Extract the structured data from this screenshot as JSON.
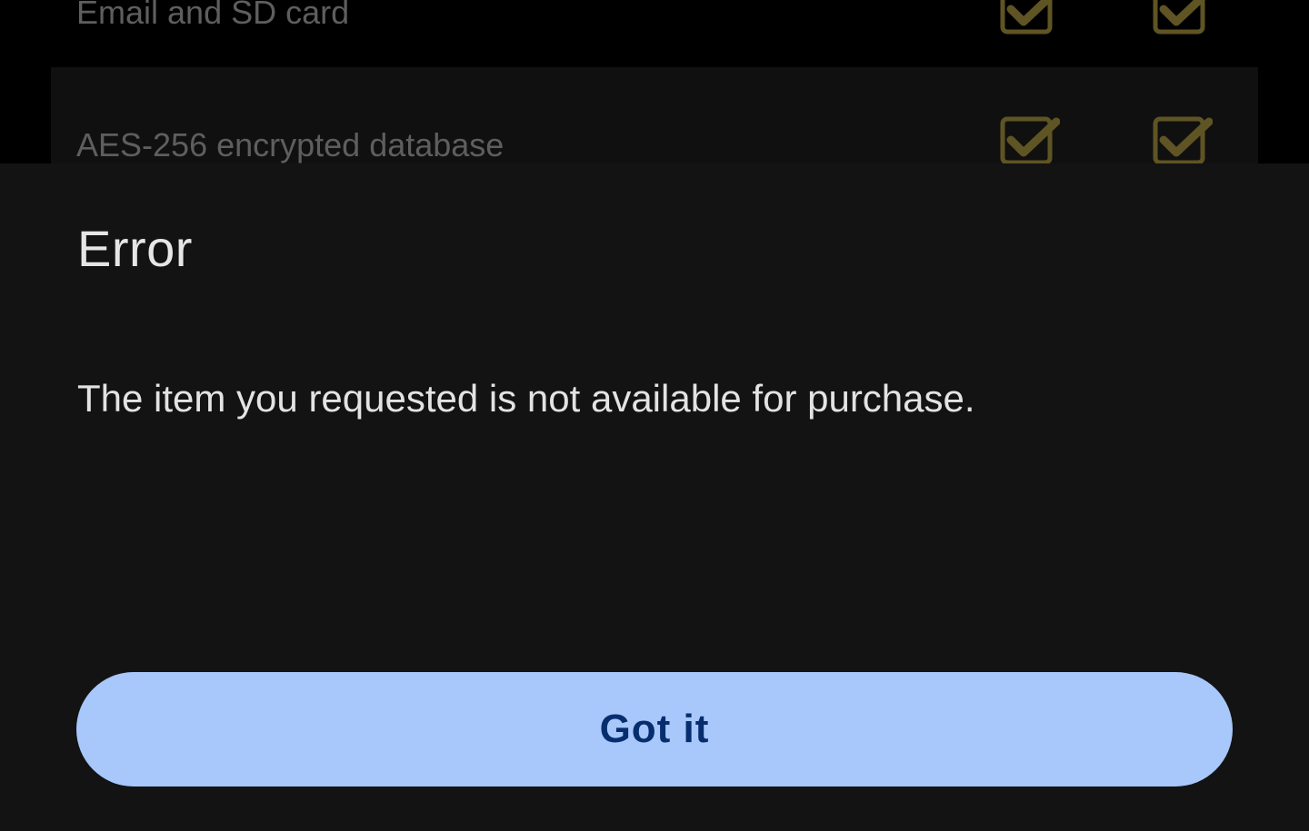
{
  "background_list": {
    "rows": [
      {
        "label": "Email and SD card",
        "col_a_checked": true,
        "col_b_checked": true
      },
      {
        "label": "AES-256 encrypted database",
        "col_a_checked": true,
        "col_b_checked": true
      }
    ],
    "check_color": "#5f5423"
  },
  "dialog": {
    "title": "Error",
    "message": "The item you requested is not available for purchase.",
    "button_label": "Got it"
  },
  "colors": {
    "sheet_background": "#131314",
    "button_background": "#a8c7fa",
    "button_text": "#062e6f",
    "title_text": "#e6e6e6"
  }
}
